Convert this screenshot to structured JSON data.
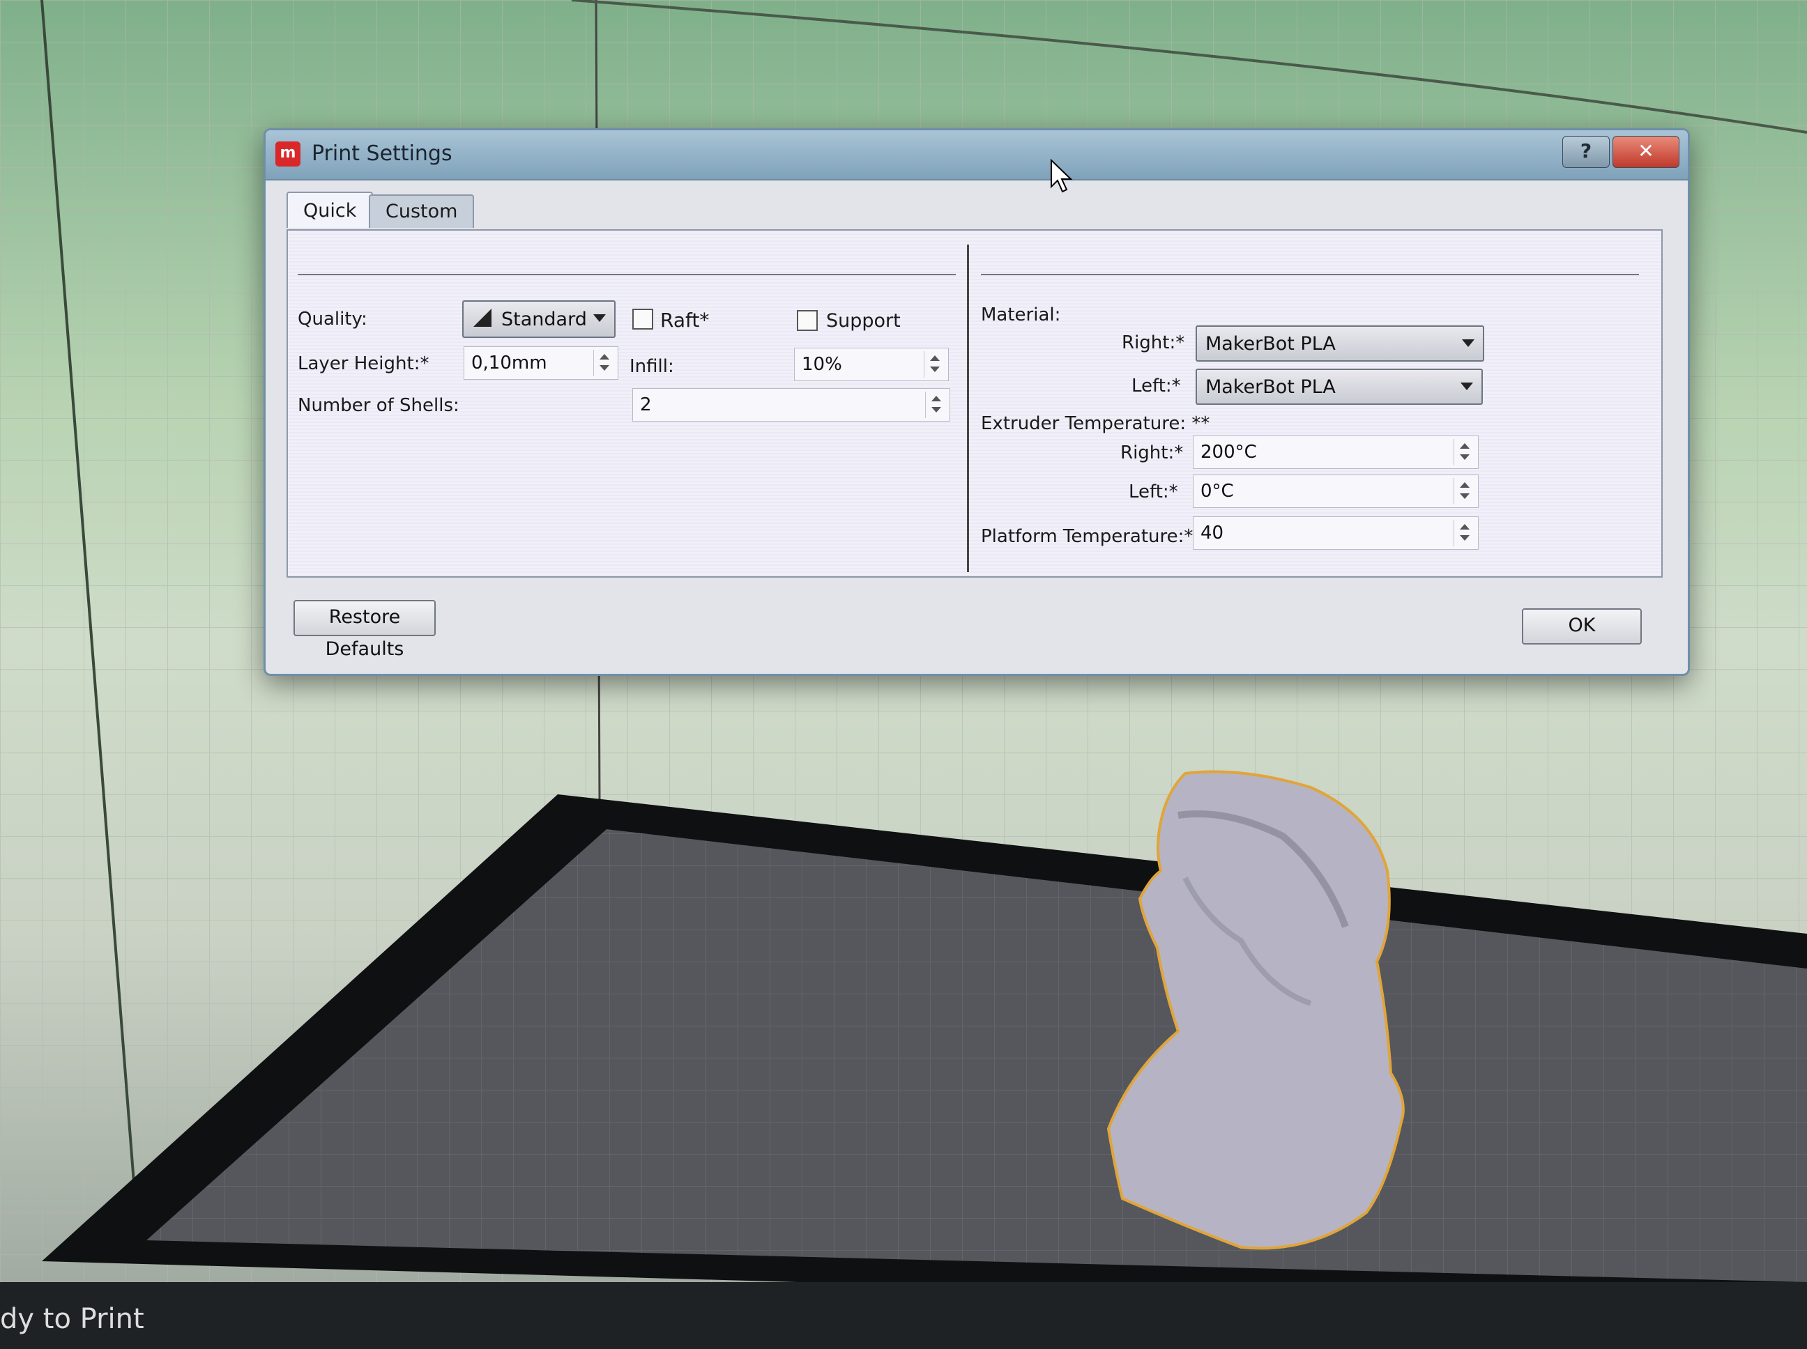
{
  "dialog": {
    "title": "Print Settings",
    "help_label": "?",
    "close_label": "✕",
    "tabs": [
      {
        "label": "Quick",
        "active": true
      },
      {
        "label": "Custom",
        "active": false
      }
    ],
    "quick": {
      "quality_label": "Quality:",
      "quality_value": "Standard",
      "raft_label": "Raft*",
      "raft_checked": false,
      "support_label": "Support",
      "support_checked": false,
      "layer_height_label": "Layer Height:*",
      "layer_height_value": "0,10mm",
      "infill_label": "Infill:",
      "infill_value": "10%",
      "shells_label": "Number of Shells:",
      "shells_value": "2"
    },
    "material": {
      "heading": "Material:",
      "right_label": "Right:*",
      "right_value": "MakerBot PLA",
      "left_label": "Left:*",
      "left_value": "MakerBot PLA"
    },
    "extruder": {
      "heading": "Extruder Temperature: **",
      "right_label": "Right:*",
      "right_value": "200°C",
      "left_label": "Left:*",
      "left_value": "0°C"
    },
    "platform": {
      "label": "Platform Temperature:*",
      "value": "40"
    },
    "restore_label": "Restore Defaults",
    "ok_label": "OK"
  },
  "status_text": "dy to Print",
  "colors": {
    "accent_red": "#d8282a",
    "titlebar": "#8fb0c6",
    "build_plate": "#55575c",
    "model_outline": "#e0a53a"
  }
}
